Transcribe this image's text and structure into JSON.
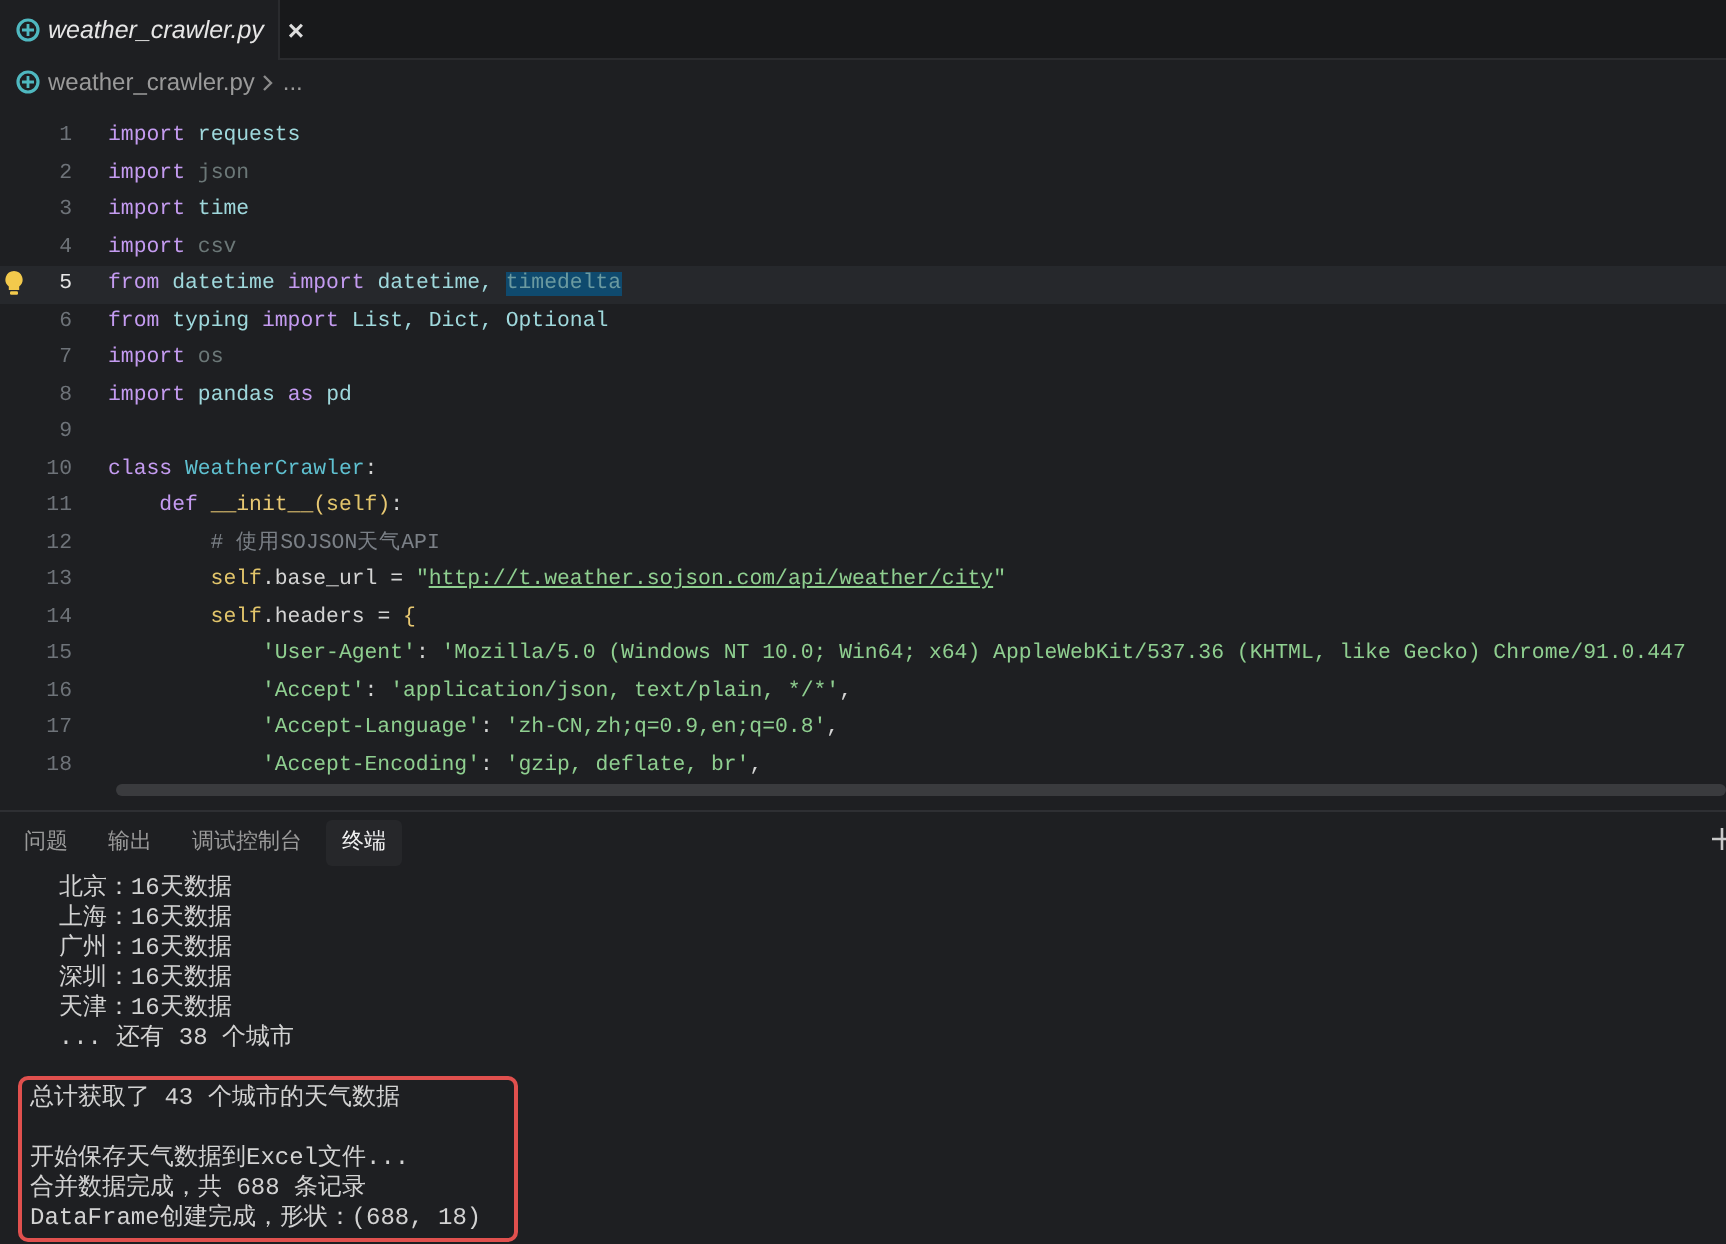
{
  "editor_tab": {
    "title": "weather_crawler.py",
    "close": "×",
    "selected": true
  },
  "breadcrumb": {
    "file": "weather_crawler.py",
    "more": "..."
  },
  "code_lines": [
    {
      "number": "1",
      "tokens": [
        {
          "kind": "kw",
          "text": "import "
        },
        {
          "kind": "name",
          "text": "requests"
        }
      ]
    },
    {
      "number": "2",
      "tokens": [
        {
          "kind": "kw",
          "text": "import "
        },
        {
          "kind": "dim",
          "text": "json"
        }
      ]
    },
    {
      "number": "3",
      "tokens": [
        {
          "kind": "kw",
          "text": "import "
        },
        {
          "kind": "name",
          "text": "time"
        }
      ]
    },
    {
      "number": "4",
      "tokens": [
        {
          "kind": "kw",
          "text": "import "
        },
        {
          "kind": "dim",
          "text": "csv"
        }
      ]
    },
    {
      "number": "5",
      "current": true,
      "tokens": [
        {
          "kind": "kw",
          "text": "from "
        },
        {
          "kind": "name",
          "text": "datetime "
        },
        {
          "kind": "kw",
          "text": "import "
        },
        {
          "kind": "name",
          "text": "datetime, "
        },
        {
          "kind": "sel",
          "text": "timedelta"
        }
      ]
    },
    {
      "number": "6",
      "tokens": [
        {
          "kind": "kw",
          "text": "from "
        },
        {
          "kind": "name",
          "text": "typing "
        },
        {
          "kind": "kw",
          "text": "import "
        },
        {
          "kind": "name",
          "text": "List, Dict, Optional"
        }
      ]
    },
    {
      "number": "7",
      "tokens": [
        {
          "kind": "kw",
          "text": "import "
        },
        {
          "kind": "dim",
          "text": "os"
        }
      ]
    },
    {
      "number": "8",
      "tokens": [
        {
          "kind": "kw",
          "text": "import "
        },
        {
          "kind": "name",
          "text": "pandas "
        },
        {
          "kind": "kw",
          "text": "as "
        },
        {
          "kind": "name",
          "text": "pd"
        }
      ]
    },
    {
      "number": "9"
    },
    {
      "number": "10",
      "tokens": [
        {
          "kind": "kw",
          "text": "class "
        },
        {
          "kind": "cls",
          "text": "WeatherCrawler"
        },
        {
          "kind": "plain",
          "text": ":"
        }
      ]
    },
    {
      "number": "11",
      "tokens": [
        {
          "kind": "kw",
          "text": "    def "
        },
        {
          "kind": "fn",
          "text": "__init__"
        },
        {
          "kind": "paren",
          "text": "("
        },
        {
          "kind": "self",
          "text": "self"
        },
        {
          "kind": "paren",
          "text": ")"
        },
        {
          "kind": "plain",
          "text": ":"
        }
      ]
    },
    {
      "number": "12",
      "tokens": [
        {
          "kind": "cmt",
          "text": "        # 使用SOJSON天气API"
        }
      ]
    },
    {
      "number": "13",
      "tokens": [
        {
          "kind": "self",
          "text": "        self"
        },
        {
          "kind": "plain",
          "text": ".base_url = "
        },
        {
          "kind": "str",
          "text": "\""
        },
        {
          "kind": "url",
          "text": "http://t.weather.sojson.com/api/weather/city"
        },
        {
          "kind": "str",
          "text": "\""
        }
      ]
    },
    {
      "number": "14",
      "tokens": [
        {
          "kind": "self",
          "text": "        self"
        },
        {
          "kind": "plain",
          "text": ".headers = "
        },
        {
          "kind": "paren",
          "text": "{"
        }
      ]
    },
    {
      "number": "15",
      "tokens": [
        {
          "kind": "str",
          "text": "            'User-Agent'"
        },
        {
          "kind": "plain",
          "text": ": "
        },
        {
          "kind": "str",
          "text": "'Mozilla/5.0 (Windows NT 10.0; Win64; x64) AppleWebKit/537.36 (KHTML, like Gecko) Chrome/91.0.447"
        }
      ]
    },
    {
      "number": "16",
      "tokens": [
        {
          "kind": "str",
          "text": "            'Accept'"
        },
        {
          "kind": "plain",
          "text": ": "
        },
        {
          "kind": "str",
          "text": "'application/json, text/plain, */*'"
        },
        {
          "kind": "plain",
          "text": ","
        }
      ]
    },
    {
      "number": "17",
      "tokens": [
        {
          "kind": "str",
          "text": "            'Accept-Language'"
        },
        {
          "kind": "plain",
          "text": ": "
        },
        {
          "kind": "str",
          "text": "'zh-CN,zh;q=0.9,en;q=0.8'"
        },
        {
          "kind": "plain",
          "text": ","
        }
      ]
    },
    {
      "number": "18",
      "tokens": [
        {
          "kind": "str",
          "text": "            'Accept-Encoding'"
        },
        {
          "kind": "plain",
          "text": ": "
        },
        {
          "kind": "str",
          "text": "'gzip, deflate, br'"
        },
        {
          "kind": "plain",
          "text": ","
        }
      ]
    }
  ],
  "panel_tabs": [
    {
      "label": "问题",
      "selected": false
    },
    {
      "label": "输出",
      "selected": false
    },
    {
      "label": "调试控制台",
      "selected": false
    },
    {
      "label": "终端",
      "selected": true
    }
  ],
  "terminal": {
    "lines": [
      "  北京：16天数据",
      "  上海：16天数据",
      "  广州：16天数据",
      "  深圳：16天数据",
      "  天津：16天数据",
      "  ... 还有 38 个城市"
    ],
    "boxed_paragraphs": [
      [
        "总计获取了 43 个城市的天气数据"
      ],
      [
        "开始保存天气数据到Excel文件...",
        "合并数据完成，共 688 条记录",
        "DataFrame创建完成，形状：(688, 18)"
      ]
    ]
  }
}
